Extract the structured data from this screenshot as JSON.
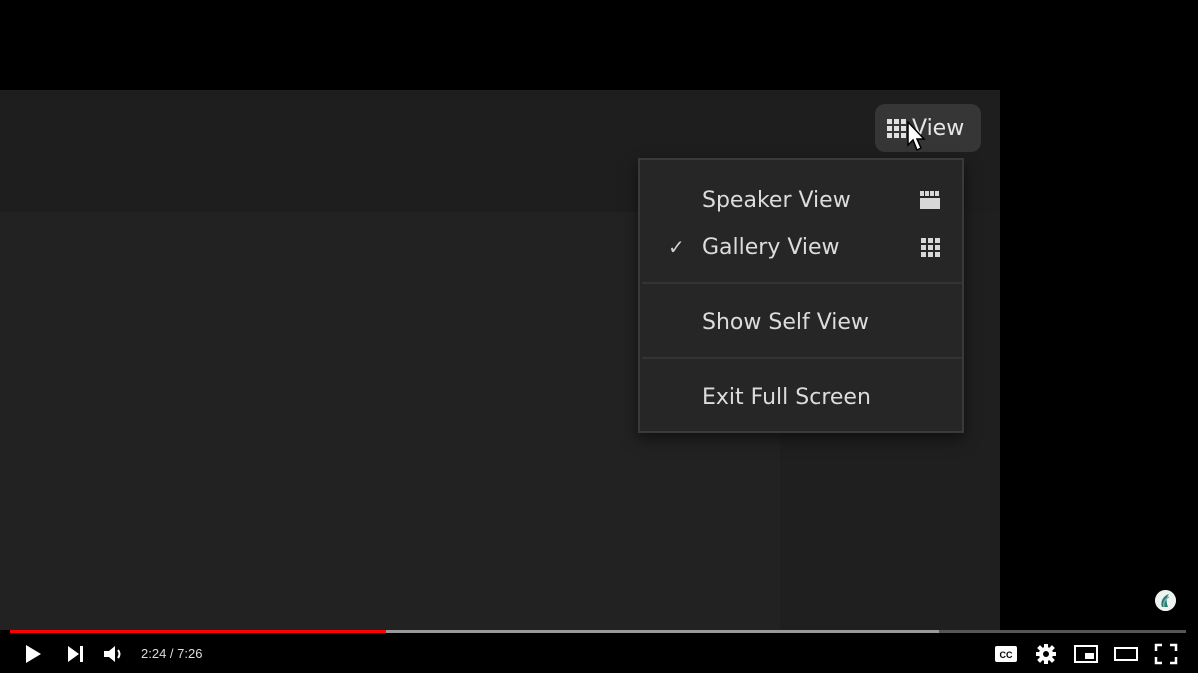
{
  "video": {
    "view_button": {
      "label": "View",
      "icon": "gallery-grid-icon"
    },
    "view_menu": {
      "items": [
        {
          "label": "Speaker View",
          "checked": false,
          "icon": "speaker-view-icon"
        },
        {
          "label": "Gallery View",
          "checked": true,
          "icon": "gallery-view-icon"
        },
        {
          "label": "Show Self View",
          "checked": false
        },
        {
          "label": "Exit Full Screen",
          "checked": false
        }
      ],
      "check_glyph": "✓"
    }
  },
  "player": {
    "current_time": "2:24",
    "duration": "7:26",
    "time_text": "2:24 / 7:26",
    "progress_played_fraction": 0.32,
    "progress_buffered_fraction": 0.79,
    "accent_color": "#ff0000",
    "controls": [
      "play-icon",
      "next-icon",
      "volume-icon",
      "captions-icon",
      "settings-icon",
      "miniplayer-icon",
      "theater-mode-icon",
      "fullscreen-icon"
    ]
  }
}
